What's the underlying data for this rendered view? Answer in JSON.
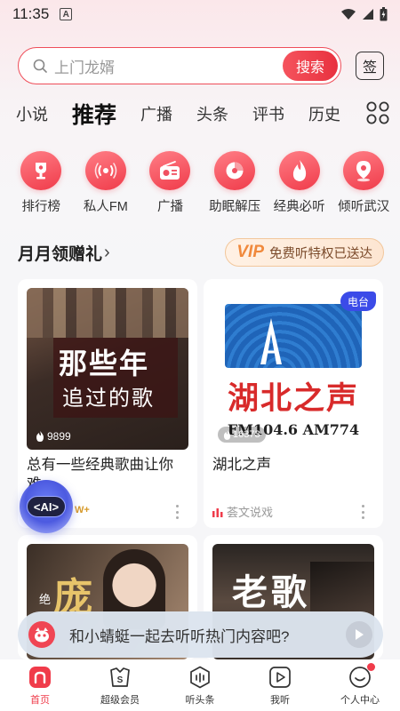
{
  "status": {
    "time": "11:35",
    "notif_letter": "A"
  },
  "search": {
    "placeholder": "上门龙婿",
    "button": "搜索",
    "sign": "签"
  },
  "tabs": [
    {
      "label": "小说"
    },
    {
      "label": "推荐"
    },
    {
      "label": "广播"
    },
    {
      "label": "头条"
    },
    {
      "label": "评书"
    },
    {
      "label": "历史"
    }
  ],
  "quick_entries": [
    {
      "label": "排行榜",
      "icon": "trophy-icon"
    },
    {
      "label": "私人FM",
      "icon": "radio-wave-icon"
    },
    {
      "label": "广播",
      "icon": "radio-icon"
    },
    {
      "label": "助眠解压",
      "icon": "moon-icon"
    },
    {
      "label": "经典必听",
      "icon": "flame-icon"
    },
    {
      "label": "倾听武汉",
      "icon": "location-icon"
    }
  ],
  "gift": {
    "title": "月月领赠礼",
    "arrow": "›",
    "vip_badge": "VIP",
    "vip_text": "免费听特权已送达"
  },
  "cards": [
    {
      "cover_line1": "那些年",
      "cover_line2": "追过的歌",
      "plays": "9899",
      "title_line1": "总有一些经典歌曲让你",
      "title_line2": "难",
      "badge": "W+"
    },
    {
      "tag": "电台",
      "cover_name": "湖北之声",
      "cover_freq": "FM104.6 AM774",
      "plays": "16373",
      "title": "湖北之声",
      "sub": "荟文说戏"
    },
    {
      "cover_text": "庞",
      "cover_side": "绝"
    },
    {
      "cover_text": "老歌"
    }
  ],
  "ai_fab": {
    "label": "<AI>"
  },
  "prompt": {
    "text": "和小蜻蜓一起去听听热门内容吧?"
  },
  "nav": [
    {
      "label": "首页",
      "icon": "home-icon"
    },
    {
      "label": "超级会员",
      "icon": "vip-icon"
    },
    {
      "label": "听头条",
      "icon": "headline-icon"
    },
    {
      "label": "我听",
      "icon": "play-list-icon"
    },
    {
      "label": "个人中心",
      "icon": "profile-icon"
    }
  ],
  "colors": {
    "accent": "#ef3b4a",
    "vip": "#f0893c"
  }
}
